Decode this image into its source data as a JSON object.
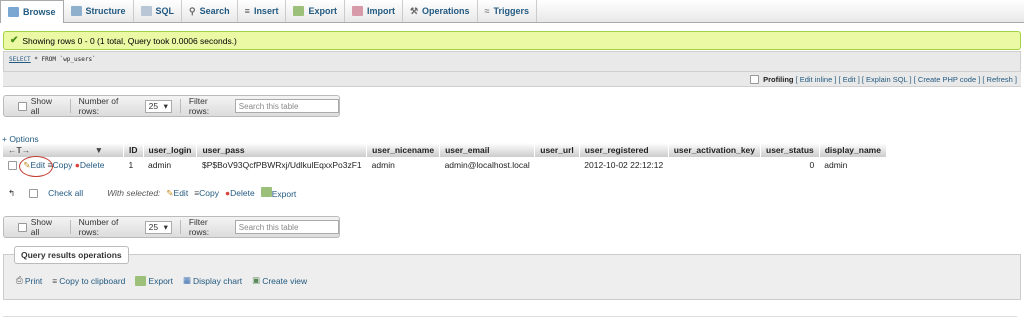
{
  "tabs": [
    {
      "label": "Browse",
      "icon": "browse-icon"
    },
    {
      "label": "Structure",
      "icon": "structure-icon"
    },
    {
      "label": "SQL",
      "icon": "sql-icon"
    },
    {
      "label": "Search",
      "icon": "search-icon"
    },
    {
      "label": "Insert",
      "icon": "insert-icon"
    },
    {
      "label": "Export",
      "icon": "export-icon"
    },
    {
      "label": "Import",
      "icon": "import-icon"
    },
    {
      "label": "Operations",
      "icon": "wrench-icon"
    },
    {
      "label": "Triggers",
      "icon": "triggers-icon"
    }
  ],
  "status": {
    "message": "Showing rows 0 - 0 (1 total, Query took 0.0006 seconds.)"
  },
  "sql": {
    "keyword": "SELECT",
    "rest": " * FROM `wp_users`"
  },
  "profiling": {
    "label": "Profiling",
    "links": [
      "[ Edit inline ]",
      "[ Edit ]",
      "[ Explain SQL ]",
      "[ Create PHP code ]",
      "[ Refresh ]"
    ]
  },
  "nav": {
    "show_all": "Show all",
    "rows_label": "Number of rows:",
    "rows_value": "25",
    "filter_label": "Filter rows:",
    "filter_placeholder": "Search this table"
  },
  "options_link": "+ Options",
  "table": {
    "columns": [
      "ID",
      "user_login",
      "user_pass",
      "user_nicename",
      "user_email",
      "user_url",
      "user_registered",
      "user_activation_key",
      "user_status",
      "display_name"
    ],
    "row": {
      "edit": "Edit",
      "copy": "Copy",
      "delete": "Delete",
      "cells": [
        "1",
        "admin",
        "$P$BoV93QcfPBWRxj/UdlkulEqxxPo3zF1",
        "admin",
        "admin@localhost.local",
        "",
        "2012-10-02 22:12:12",
        "",
        "0",
        "admin"
      ]
    }
  },
  "with_selected": {
    "check_all": "Check all",
    "label": "With selected:",
    "edit": "Edit",
    "copy": "Copy",
    "delete": "Delete",
    "export": "Export"
  },
  "query_ops": {
    "title": "Query results operations",
    "links": [
      "Print",
      "Copy to clipboard",
      "Export",
      "Display chart",
      "Create view"
    ]
  },
  "colors": {
    "link": "#235a81",
    "success_bg": "#ebf8a4",
    "delete_red": "#d9453b"
  }
}
